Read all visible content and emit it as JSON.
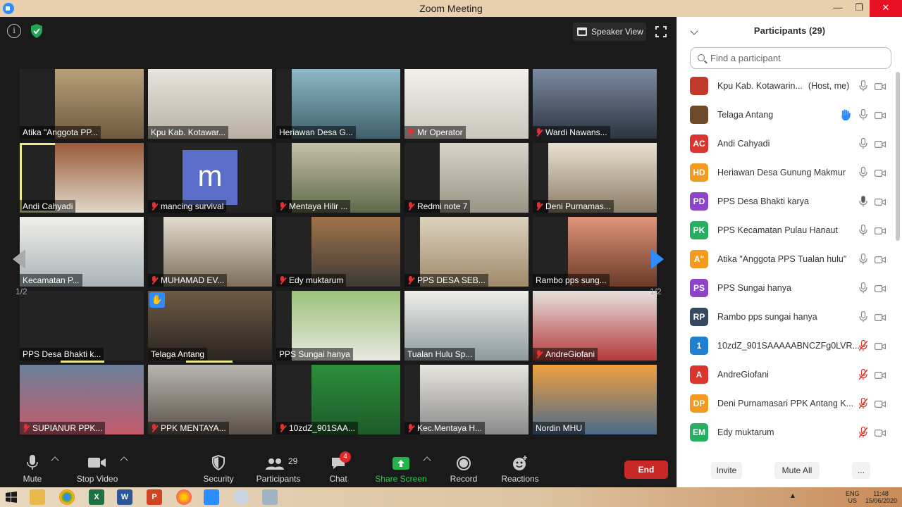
{
  "window": {
    "title": "Zoom Meeting",
    "minimize": "—",
    "maximize": "❐",
    "close": "✕"
  },
  "top_bar": {
    "speaker_view_label": "Speaker View"
  },
  "tiles": [
    {
      "name": "Atika \"Anggota PP...",
      "muted": false
    },
    {
      "name": "Kpu Kab. Kotawar...",
      "muted": false
    },
    {
      "name": "Heriawan Desa G...",
      "muted": false
    },
    {
      "name": "Mr Operator",
      "muted": true
    },
    {
      "name": "Wardi Nawans...",
      "muted": true
    },
    {
      "name": "Andi Cahyadi",
      "muted": false,
      "active": true
    },
    {
      "name": "mancing survival",
      "muted": true,
      "avatar_letter": "m"
    },
    {
      "name": "Mentaya Hilir ...",
      "muted": true
    },
    {
      "name": "Redmi note 7",
      "muted": true
    },
    {
      "name": "Deni Purnamas...",
      "muted": true
    },
    {
      "name": "Kecamatan P...",
      "muted": false
    },
    {
      "name": "MUHAMAD EV...",
      "muted": true
    },
    {
      "name": "Edy muktarum",
      "muted": true
    },
    {
      "name": "PPS DESA SEB...",
      "muted": true
    },
    {
      "name": "Rambo pps sung...",
      "muted": false
    },
    {
      "name": "PPS Desa Bhakti k...",
      "muted": false
    },
    {
      "name": "Telaga Antang",
      "muted": false,
      "hand_raised": true
    },
    {
      "name": "PPS Sungai hanya",
      "muted": false
    },
    {
      "name": "Tualan Hulu Sp...",
      "muted": false
    },
    {
      "name": "AndreGiofani",
      "muted": true
    },
    {
      "name": "SUPIANUR PPK...",
      "muted": true
    },
    {
      "name": "PPK MENTAYA...",
      "muted": true
    },
    {
      "name": "10zdZ_901SAA...",
      "muted": true
    },
    {
      "name": "Kec.Mentaya H...",
      "muted": true
    },
    {
      "name": "Nordin MHU",
      "muted": false
    }
  ],
  "pagination": {
    "left": "1/2",
    "right": "1/2"
  },
  "toolbar": {
    "mute": "Mute",
    "stop_video": "Stop Video",
    "security": "Security",
    "participants": "Participants",
    "participants_count": "29",
    "chat": "Chat",
    "chat_badge": "4",
    "share_screen": "Share Screen",
    "record": "Record",
    "reactions": "Reactions",
    "end": "End"
  },
  "participants_panel": {
    "title": "Participants (29)",
    "search_placeholder": "Find a participant",
    "items": [
      {
        "name": "Kpu Kab. Kotawarin...",
        "suffix": "(Host, me)",
        "initials": "",
        "color": "#c0392b",
        "mic": "on"
      },
      {
        "name": "Telaga Antang",
        "initials": "",
        "color": "#6b4a2a",
        "mic": "on",
        "hand": true
      },
      {
        "name": "Andi Cahyadi",
        "initials": "AC",
        "color": "#d9352e",
        "mic": "on"
      },
      {
        "name": "Heriawan Desa Gunung Makmur",
        "initials": "HD",
        "color": "#f29a1f",
        "mic": "on"
      },
      {
        "name": "PPS Desa Bhakti karya",
        "initials": "PD",
        "color": "#8e44c9",
        "mic": "talking"
      },
      {
        "name": "PPS Kecamatan Pulau Hanaut",
        "initials": "PK",
        "color": "#27ae60",
        "mic": "on"
      },
      {
        "name": "Atika \"Anggota PPS Tualan hulu\"",
        "initials": "A\"",
        "color": "#f29a1f",
        "mic": "on"
      },
      {
        "name": "PPS Sungai hanya",
        "initials": "PS",
        "color": "#8e44c9",
        "mic": "on"
      },
      {
        "name": "Rambo pps sungai hanya",
        "initials": "RP",
        "color": "#34495e",
        "mic": "on"
      },
      {
        "name": "10zdZ_901SAAAAABNCZFg0LVR...",
        "initials": "1",
        "color": "#1f7fd1",
        "mic": "muted"
      },
      {
        "name": "AndreGiofani",
        "initials": "A",
        "color": "#d9352e",
        "mic": "muted"
      },
      {
        "name": "Deni Purnamasari PPK Antang K...",
        "initials": "DP",
        "color": "#f29a1f",
        "mic": "muted"
      },
      {
        "name": "Edy muktarum",
        "initials": "EM",
        "color": "#27ae60",
        "mic": "muted"
      }
    ],
    "invite": "Invite",
    "mute_all": "Mute All",
    "more": "..."
  },
  "taskbar": {
    "lang": "ENG",
    "region": "US",
    "time": "11:48",
    "date": "15/06/2020"
  }
}
